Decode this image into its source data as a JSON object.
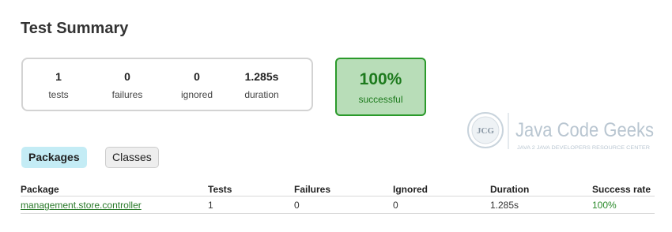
{
  "page": {
    "title": "Test Summary"
  },
  "summary": {
    "counters": [
      {
        "value": "1",
        "label": "tests"
      },
      {
        "value": "0",
        "label": "failures"
      },
      {
        "value": "0",
        "label": "ignored"
      },
      {
        "value": "1.285s",
        "label": "duration"
      }
    ],
    "success": {
      "value": "100%",
      "label": "successful"
    }
  },
  "logo": {
    "monogram": "JCG",
    "brand": "Java Code Geeks",
    "tagline": "JAVA 2 JAVA DEVELOPERS RESOURCE CENTER"
  },
  "tabs": [
    {
      "label": "Packages"
    },
    {
      "label": "Classes"
    }
  ],
  "table": {
    "headers": [
      "Package",
      "Tests",
      "Failures",
      "Ignored",
      "Duration",
      "Success rate"
    ],
    "rows": [
      [
        "management.store.controller",
        "1",
        "0",
        "0",
        "1.285s",
        "100%"
      ]
    ]
  },
  "colors": {
    "success_green": "#1d7a1d",
    "success_bg": "#b8ddb8",
    "active_tab_bg": "#c4ecf5"
  }
}
